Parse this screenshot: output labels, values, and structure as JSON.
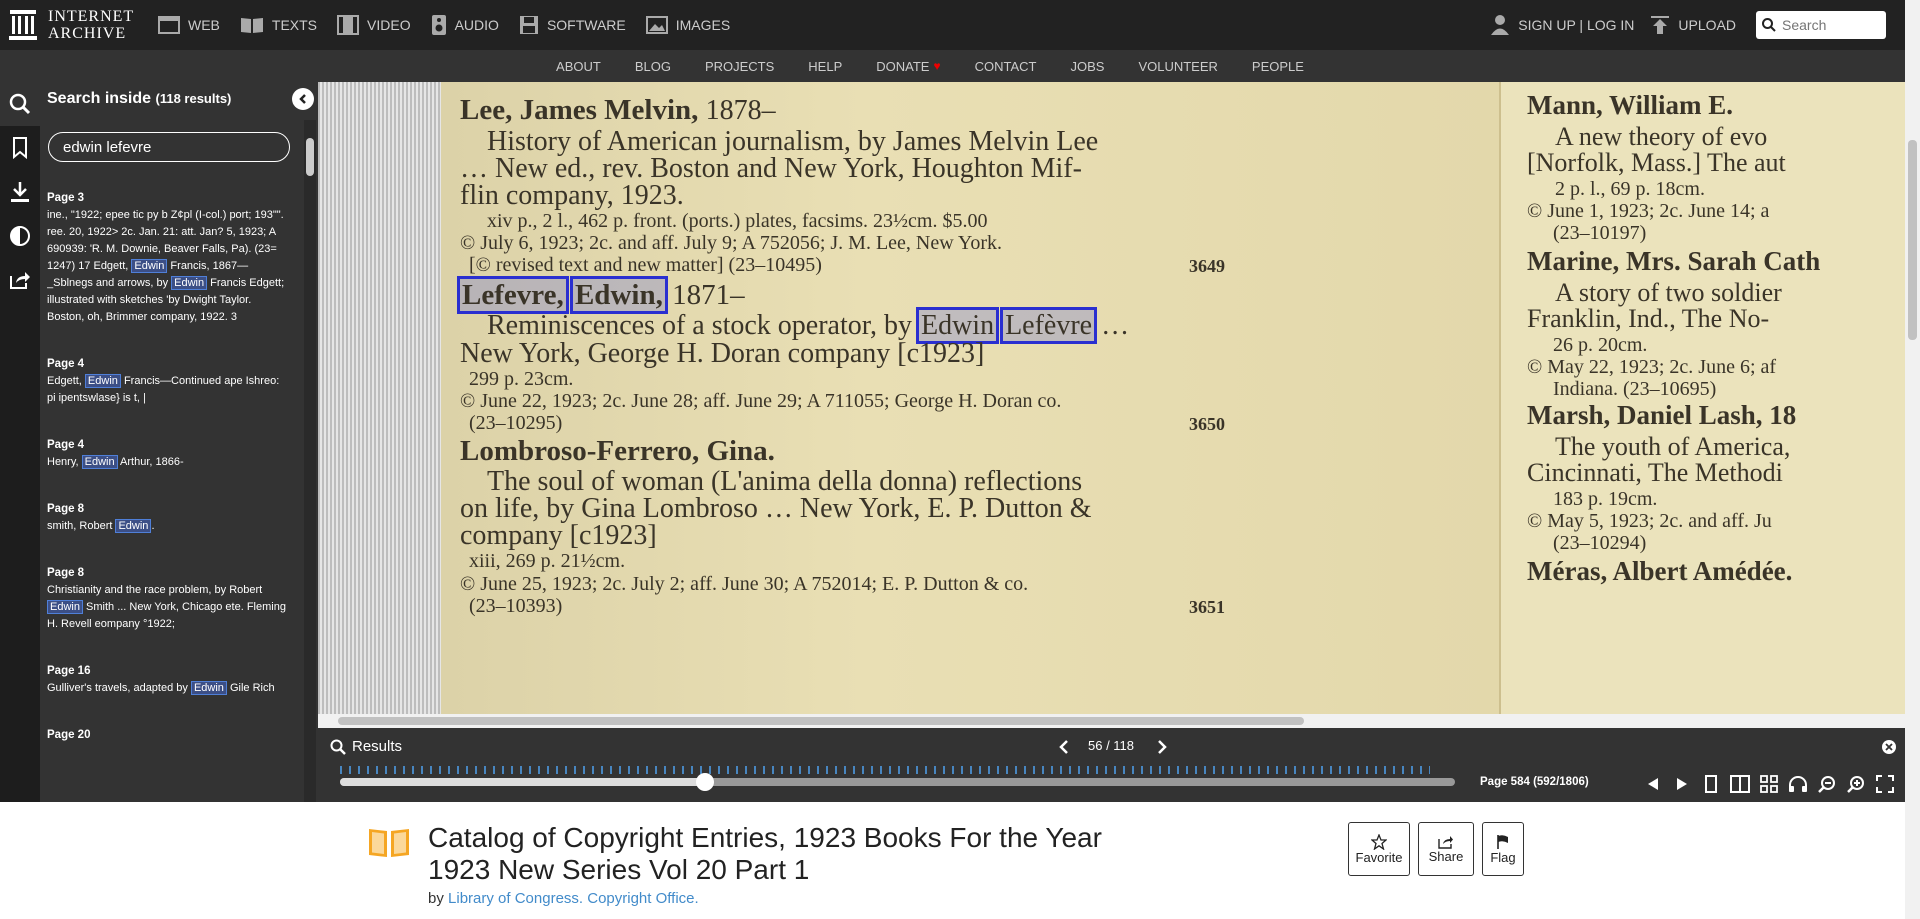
{
  "topnav": {
    "logo_line1": "INTERNET",
    "logo_line2": "ARCHIVE",
    "media": [
      "WEB",
      "TEXTS",
      "VIDEO",
      "AUDIO",
      "SOFTWARE",
      "IMAGES"
    ],
    "signup": "SIGN UP | LOG IN",
    "upload": "UPLOAD",
    "search_placeholder": "Search"
  },
  "subnav": [
    "ABOUT",
    "BLOG",
    "PROJECTS",
    "HELP",
    "DONATE",
    "CONTACT",
    "JOBS",
    "VOLUNTEER",
    "PEOPLE"
  ],
  "search_panel": {
    "title": "Search inside",
    "count": "(118 results)",
    "query": "edwin lefevre",
    "results": [
      {
        "page": "Page 3",
        "parts": [
          "ine., \"1922; epee tic py b Z¢pl (I-col.) port; 193\"\". ree. 20, 1922> 2c. Jan. 21: att. Jan? 5, 1923; A 690939: 'R. M. Downie, Beaver Falls, Pa). (23= 1247) 17 Edgett, ",
          "Edwin",
          " Francis, 1867— _Sblnegs and arrows, by ",
          "Edwin",
          " Francis Edgett; illustrated with sketches 'by Dwight Taylor. Boston, oh, Brimmer company, 1922. 3"
        ]
      },
      {
        "page": "Page 4",
        "parts": [
          "Edgett, ",
          "Edwin",
          " Francis—Continued ape Ishreo: pi ipentswlase} is t, |"
        ]
      },
      {
        "page": "Page 4",
        "parts": [
          "Henry, ",
          "Edwin",
          " Arthur, 1866-"
        ]
      },
      {
        "page": "Page 8",
        "parts": [
          "smith, Robert ",
          "Edwin",
          "."
        ]
      },
      {
        "page": "Page 8",
        "parts": [
          "Christianity and the race problem, by Robert ",
          "Edwin",
          " Smith ... New York, Chicago ete. Fleming H. Revell eompany °1922;"
        ]
      },
      {
        "page": "Page 16",
        "parts": [
          "Gulliver's travels, adapted by ",
          "Edwin",
          " Gile Rich"
        ]
      },
      {
        "page": "Page 20",
        "parts": [
          ""
        ]
      }
    ]
  },
  "page_main": {
    "e1_head": "Lee, James Melvin,",
    "e1_year": "1878–",
    "e1_l1": "History of American journalism, by James Melvin Lee",
    "e1_l2": "…  New ed., rev.  Boston and New York, Houghton Mif-",
    "e1_l3": "flin company, 1923.",
    "e1_l4": "xiv p., 2 l., 462 p.   front. (ports.) plates, facsims.   23½cm.     $5.00",
    "e1_l5": "© July 6, 1923; 2c. and aff. July 9; A 752056; J. M. Lee, New York.",
    "e1_l6": "[© revised text and new matter]   (23–10495)",
    "e1_num": "3649",
    "e2_w1": "Lefevre,",
    "e2_w2": "Edwin,",
    "e2_year": "1871–",
    "e2_l1a": "Reminiscences of a stock operator, by",
    "e2_l1b": "Edwin",
    "e2_l1c": "Lefèvre",
    "e2_l1d": "…",
    "e2_l2": "New York, George H. Doran company [c1923]",
    "e2_l3": "299 p.   23cm.",
    "e2_l4": "© June 22, 1923; 2c. June 28; aff. June 29; A 711055; George H. Doran co.",
    "e2_l5": "(23–10295)",
    "e2_num": "3650",
    "e3_head": "Lombroso-Ferrero, Gina.",
    "e3_l1": "The soul of woman (L'anima della donna) reflections",
    "e3_l2": "on life, by Gina Lombroso …  New York, E. P. Dutton &",
    "e3_l3": "company [c1923]",
    "e3_l4": "xiii, 269 p.   21½cm.",
    "e3_l5": "© June 25, 1923; 2c. July 2; aff. June 30; A 752014; E. P. Dutton & co.",
    "e3_l6": "(23–10393)",
    "e3_num": "3651"
  },
  "page_right": {
    "r1": "Mann, William E.",
    "r2": "A new theory of evo",
    "r3": "[Norfolk, Mass.] The aut",
    "r4": "2 p. l., 69 p.   18cm.",
    "r5": "© June 1, 1923; 2c. June 14; a",
    "r6": "(23–10197)",
    "r7": "Marine, Mrs. Sarah Cath",
    "r8": "A story of two soldier",
    "r9": "Franklin, Ind., The No-",
    "r10": "26 p.   20cm.",
    "r11": "© May 22, 1923; 2c. June 6; af",
    "r12": "Indiana.   (23–10695)",
    "r13": "Marsh, Daniel Lash, 18",
    "r14": "The youth of America,",
    "r15": "Cincinnati, The Methodi",
    "r16": "183 p.   19cm.",
    "r17": "© May 5, 1923; 2c. and aff. Ju",
    "r18": "(23–10294)",
    "r19": "Méras, Albert Amédée."
  },
  "results_bar": {
    "label": "Results",
    "counter": "56 / 118"
  },
  "navbar": {
    "page_info": "Page 584 (592/1806)",
    "progress": 0.3278
  },
  "item": {
    "title": "Catalog of Copyright Entries, 1923 Books For the Year 1923  New Series Vol 20 Part 1",
    "by": "by",
    "author": "Library of Congress. Copyright Office.",
    "actions": [
      "Favorite",
      "Share",
      "Flag"
    ]
  }
}
